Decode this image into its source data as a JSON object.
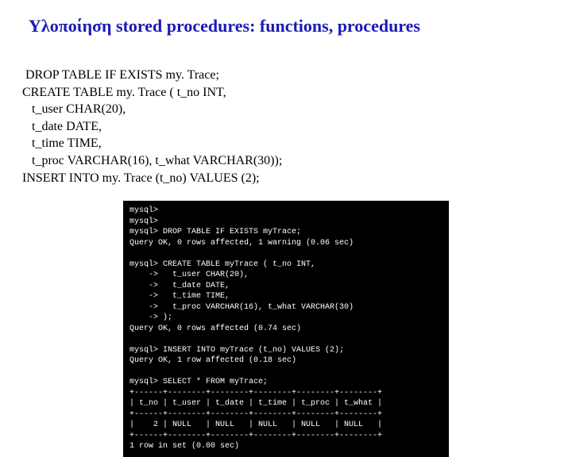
{
  "title": "Υλοποίηση stored procedures: functions, procedures",
  "sql": {
    "l1": " DROP TABLE IF EXISTS my. Trace;",
    "l2": "CREATE TABLE my. Trace ( t_no INT,",
    "l3": "   t_user CHAR(20),",
    "l4": "   t_date DATE,",
    "l5": "   t_time TIME,",
    "l6": "   t_proc VARCHAR(16), t_what VARCHAR(30));",
    "l7": "INSERT INTO my. Trace (t_no) VALUES (2);"
  },
  "term": {
    "l01": "mysql>",
    "l02": "mysql>",
    "l03": "mysql> DROP TABLE IF EXISTS myTrace;",
    "l04": "Query OK, 0 rows affected, 1 warning (0.06 sec)",
    "l05": "",
    "l06": "mysql> CREATE TABLE myTrace ( t_no INT,",
    "l07": "    ->   t_user CHAR(20),",
    "l08": "    ->   t_date DATE,",
    "l09": "    ->   t_time TIME,",
    "l10": "    ->   t_proc VARCHAR(16), t_what VARCHAR(30)",
    "l11": "    -> );",
    "l12": "Query OK, 0 rows affected (0.74 sec)",
    "l13": "",
    "l14": "mysql> INSERT INTO myTrace (t_no) VALUES (2);",
    "l15": "Query OK, 1 row affected (0.18 sec)",
    "l16": "",
    "l17": "mysql> SELECT * FROM myTrace;",
    "l18": "+------+--------+--------+--------+--------+--------+",
    "l19": "| t_no | t_user | t_date | t_time | t_proc | t_what |",
    "l20": "+------+--------+--------+--------+--------+--------+",
    "l21": "|    2 | NULL   | NULL   | NULL   | NULL   | NULL   |",
    "l22": "+------+--------+--------+--------+--------+--------+",
    "l23": "1 row in set (0.00 sec)"
  }
}
